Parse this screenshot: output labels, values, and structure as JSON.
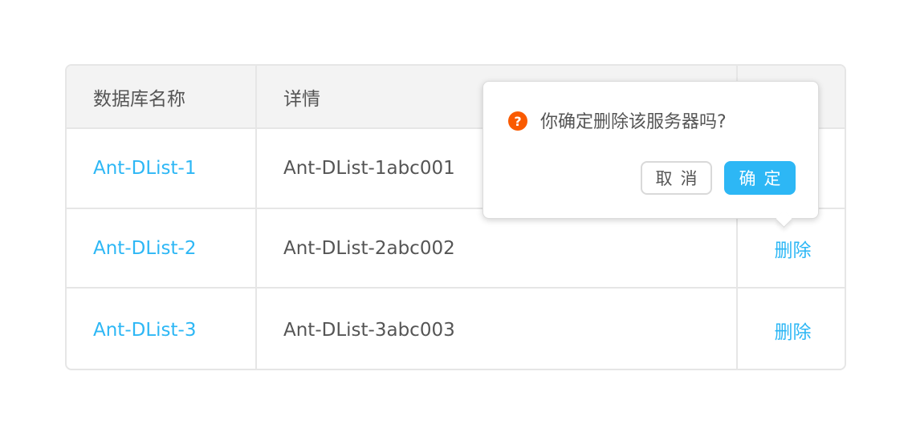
{
  "table": {
    "headers": [
      "数据库名称",
      "详情",
      ""
    ],
    "rows": [
      {
        "name": "Ant-DList-1",
        "detail": "Ant-DList-1abc001",
        "action": ""
      },
      {
        "name": "Ant-DList-2",
        "detail": "Ant-DList-2abc002",
        "action": "删除"
      },
      {
        "name": "Ant-DList-3",
        "detail": "Ant-DList-3abc003",
        "action": "删除"
      }
    ]
  },
  "popconfirm": {
    "icon": "question-icon",
    "icon_glyph": "?",
    "message": "你确定删除该服务器吗?",
    "cancel_label": "取消",
    "ok_label": "确定"
  },
  "colors": {
    "link": "#2db7f5",
    "primary": "#2db7f5",
    "warning": "#fa5a00",
    "header_bg": "#f3f3f3",
    "border": "#e6e6e6"
  }
}
